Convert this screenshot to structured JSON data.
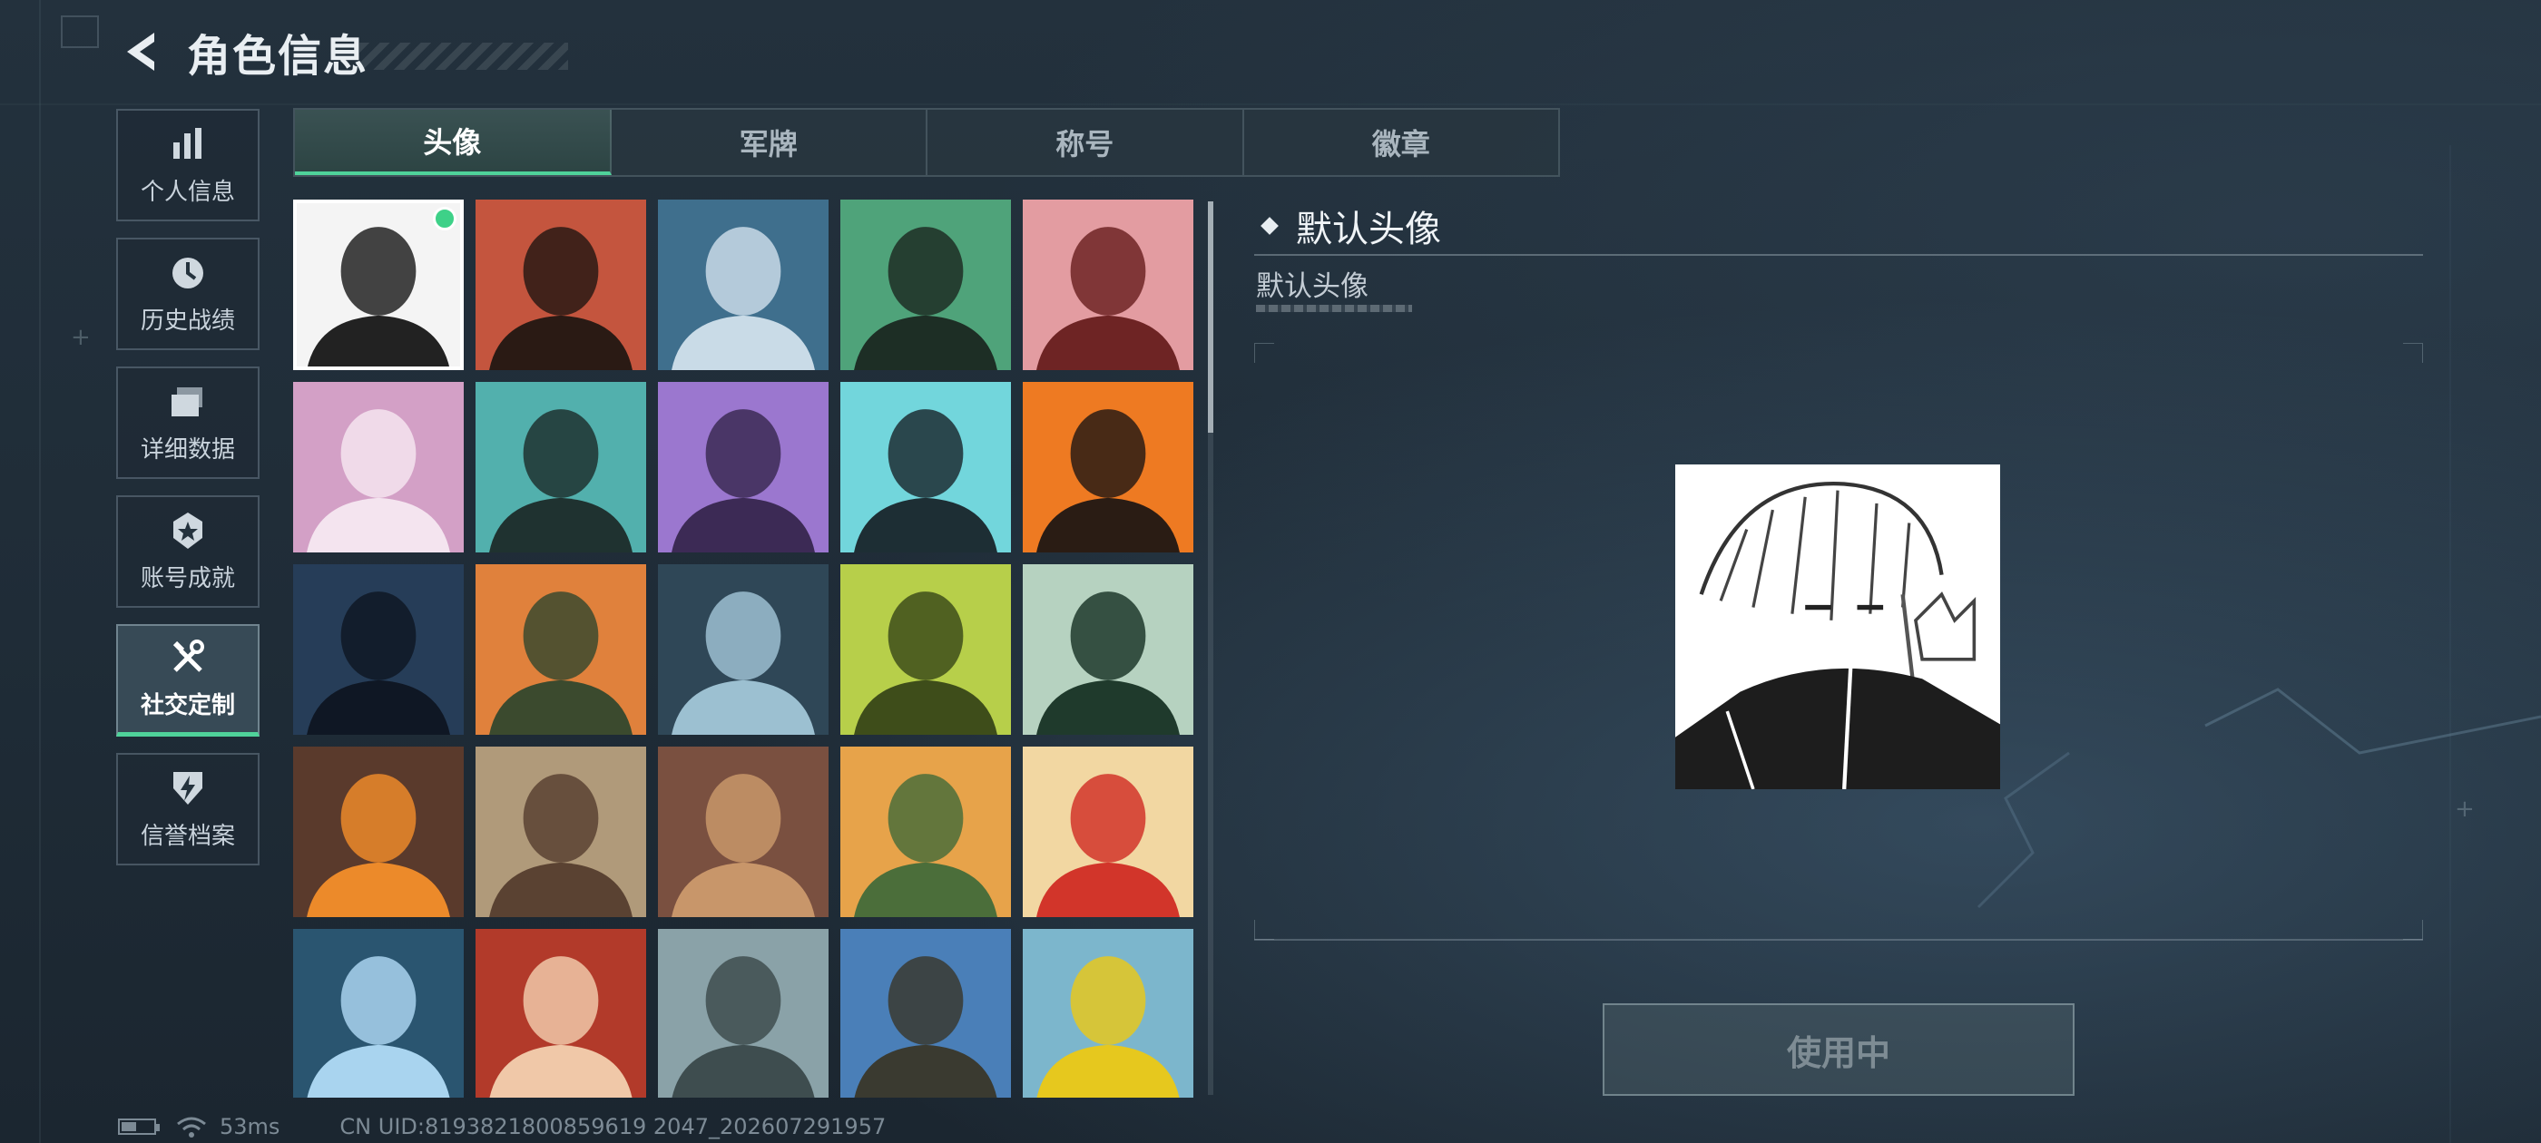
{
  "header": {
    "title": "角色信息"
  },
  "sidenav": {
    "items": [
      {
        "label": "个人信息",
        "icon": "bar-chart-icon",
        "active": false
      },
      {
        "label": "历史战绩",
        "icon": "history-clock-icon",
        "active": false
      },
      {
        "label": "详细数据",
        "icon": "folder-stack-icon",
        "active": false
      },
      {
        "label": "账号成就",
        "icon": "achievement-star-icon",
        "active": false
      },
      {
        "label": "社交定制",
        "icon": "tools-icon",
        "active": true
      },
      {
        "label": "信誉档案",
        "icon": "shield-bolt-icon",
        "active": false
      }
    ]
  },
  "tabs": [
    {
      "label": "头像",
      "active": true
    },
    {
      "label": "军牌",
      "active": false
    },
    {
      "label": "称号",
      "active": false
    },
    {
      "label": "徽章",
      "active": false
    }
  ],
  "avatars": [
    {
      "name": "avatar-sketch-girl",
      "bg": "#f4f4f4",
      "fg": "#222222",
      "selected": true
    },
    {
      "name": "avatar-bearded-cap",
      "bg": "#c4553e",
      "fg": "#2a1a14",
      "selected": false
    },
    {
      "name": "avatar-headset-woman",
      "bg": "#3f6f8d",
      "fg": "#c9dbe7",
      "selected": false
    },
    {
      "name": "avatar-green-headset-man",
      "bg": "#4fa37a",
      "fg": "#1d2e25",
      "selected": false
    },
    {
      "name": "avatar-helmet-soldier",
      "bg": "#e39ca1",
      "fg": "#6e2424",
      "selected": false
    },
    {
      "name": "avatar-pink-hair",
      "bg": "#d3a0c6",
      "fg": "#f4e4ef",
      "selected": false
    },
    {
      "name": "avatar-bearded-teal",
      "bg": "#52b0ad",
      "fg": "#1f3230",
      "selected": false
    },
    {
      "name": "avatar-purple-woman",
      "bg": "#9b77cf",
      "fg": "#3c2a55",
      "selected": false
    },
    {
      "name": "avatar-masked-helmet",
      "bg": "#72d6dc",
      "fg": "#1d2e34",
      "selected": false
    },
    {
      "name": "avatar-orange-masked",
      "bg": "#ee7a22",
      "fg": "#2a1c14",
      "selected": false
    },
    {
      "name": "avatar-night-soldier",
      "bg": "#263d58",
      "fg": "#0f1724",
      "selected": false
    },
    {
      "name": "avatar-soldier-drone",
      "bg": "#e0813c",
      "fg": "#3b4a2e",
      "selected": false
    },
    {
      "name": "avatar-sniper-scope",
      "bg": "#2f4757",
      "fg": "#9cc0d1",
      "selected": false
    },
    {
      "name": "avatar-exit-door",
      "bg": "#b7cf4a",
      "fg": "#3e4d1a",
      "selected": false
    },
    {
      "name": "avatar-way-out-sign",
      "bg": "#b6d2c0",
      "fg": "#1f3a2c",
      "selected": false
    },
    {
      "name": "avatar-feather",
      "bg": "#5a3a2c",
      "fg": "#ec8a2a",
      "selected": false
    },
    {
      "name": "avatar-rusty-truck",
      "bg": "#b09a7a",
      "fg": "#5a4232",
      "selected": false
    },
    {
      "name": "avatar-scales-emblem",
      "bg": "#7a5040",
      "fg": "#c8966a",
      "selected": false
    },
    {
      "name": "avatar-chef-cartoon",
      "bg": "#e7a34a",
      "fg": "#4b6e3a",
      "selected": false
    },
    {
      "name": "avatar-fries-mascot",
      "bg": "#f2d7a2",
      "fg": "#d2352a",
      "selected": false
    },
    {
      "name": "avatar-lab-scientist",
      "bg": "#2a5570",
      "fg": "#a9d4ef",
      "selected": false
    },
    {
      "name": "avatar-red-hair-woman",
      "bg": "#b23a2a",
      "fg": "#f0c8a8",
      "selected": false
    },
    {
      "name": "avatar-mountain-view",
      "bg": "#8aa2a8",
      "fg": "#3e4d4f",
      "selected": false
    },
    {
      "name": "avatar-archer",
      "bg": "#4a7fb8",
      "fg": "#3a3a30",
      "selected": false
    },
    {
      "name": "avatar-alligator-sign",
      "bg": "#7cb6cc",
      "fg": "#e6c81e",
      "selected": false
    }
  ],
  "detail": {
    "title": "默认头像",
    "subtitle": "默认头像",
    "button_label": "使用中"
  },
  "status": {
    "ping": "53ms",
    "uid": "CN UID:8193821800859619 2047_202607291957"
  },
  "colors": {
    "accent": "#4fd29a",
    "selected_dot": "#3ed188"
  }
}
